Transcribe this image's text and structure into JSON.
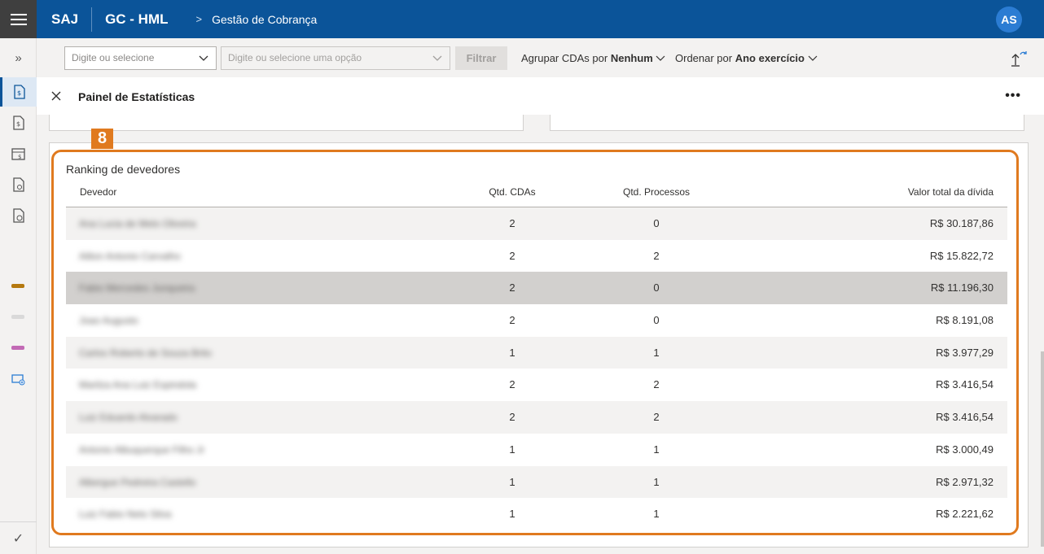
{
  "topbar": {
    "brand": "SAJ",
    "app_name": "GC - HML",
    "breadcrumb": "Gestão de Cobrança",
    "avatar_initials": "AS"
  },
  "toolbar": {
    "select1_placeholder": "Digite ou selecione",
    "select2_placeholder": "Digite ou selecione uma opção",
    "filter_button": "Filtrar",
    "group_label": "Agrupar CDAs por",
    "group_value": "Nenhum",
    "order_label": "Ordenar por",
    "order_value": "Ano exercício"
  },
  "panel": {
    "title": "Painel de Estatísticas",
    "more_label": "•••"
  },
  "annotation_badge": "8",
  "ranking": {
    "title": "Ranking de devedores",
    "columns": [
      "Devedor",
      "Qtd. CDAs",
      "Qtd. Processos",
      "Valor total da dívida"
    ],
    "rows": [
      {
        "devedor": "Ana Lucia de Melo Oliveira",
        "cdas": "2",
        "processos": "0",
        "valor": "R$ 30.187,86"
      },
      {
        "devedor": "Ailton Antonio Carvalho",
        "cdas": "2",
        "processos": "2",
        "valor": "R$ 15.822,72"
      },
      {
        "devedor": "Fabio Mercedes Junqueira",
        "cdas": "2",
        "processos": "0",
        "valor": "R$ 11.196,30"
      },
      {
        "devedor": "Joao Augusto",
        "cdas": "2",
        "processos": "0",
        "valor": "R$ 8.191,08"
      },
      {
        "devedor": "Carlos Roberto de Souza Brito",
        "cdas": "1",
        "processos": "1",
        "valor": "R$ 3.977,29"
      },
      {
        "devedor": "Marilza Ana Luiz Espindola",
        "cdas": "2",
        "processos": "2",
        "valor": "R$ 3.416,54"
      },
      {
        "devedor": "Luiz Eduardo Alvarado",
        "cdas": "2",
        "processos": "2",
        "valor": "R$ 3.416,54"
      },
      {
        "devedor": "Antonio Albuquerque Filho Jr",
        "cdas": "1",
        "processos": "1",
        "valor": "R$ 3.000,49"
      },
      {
        "devedor": "Albergue Pedreira Castello",
        "cdas": "1",
        "processos": "1",
        "valor": "R$ 2.971,32"
      },
      {
        "devedor": "Luiz Fabio Neto Silva",
        "cdas": "1",
        "processos": "1",
        "valor": "R$ 2.221,62"
      }
    ]
  },
  "colors": {
    "topbar": "#0b5499",
    "accent_orange": "#e07a1f",
    "rail_bar_1": "#b5790f",
    "rail_bar_2": "#d9d9d9",
    "rail_bar_3": "#c26ab5"
  },
  "rail": {
    "expand_icon": "»",
    "bottom_icon": "✓"
  }
}
